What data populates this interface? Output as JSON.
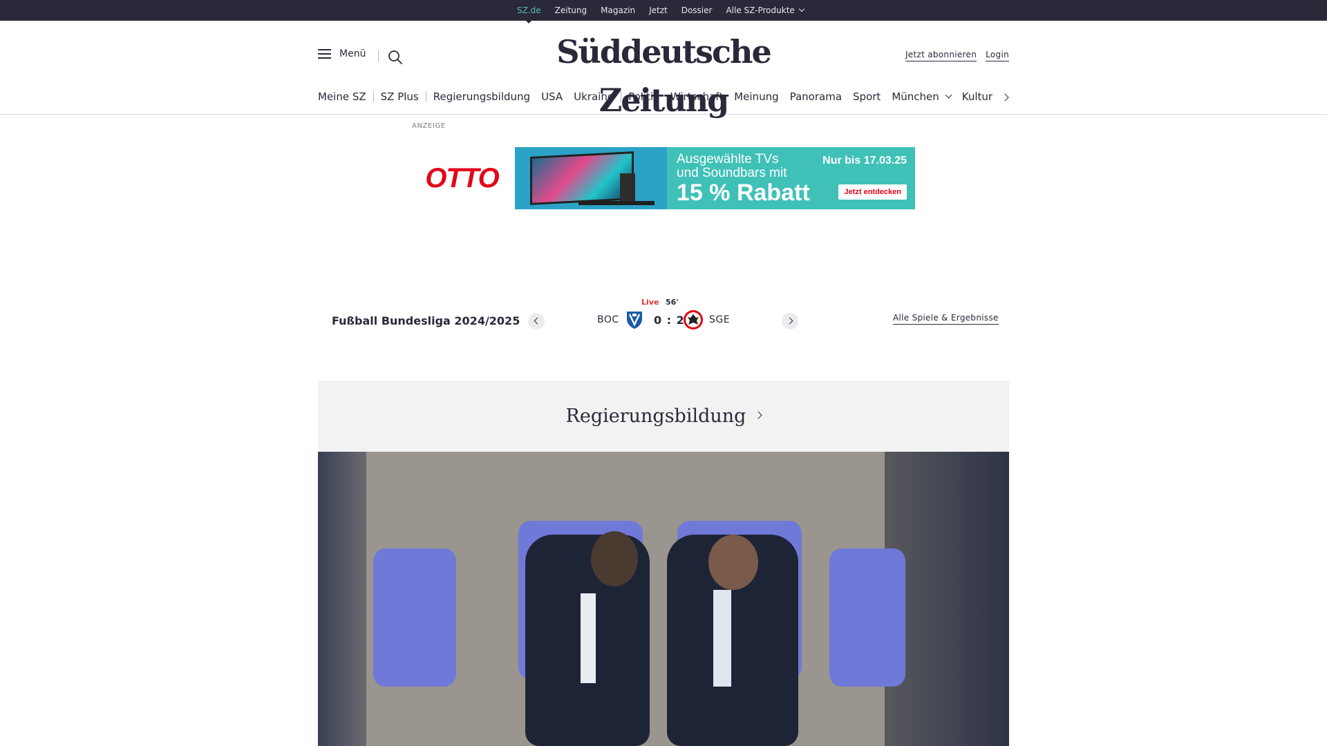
{
  "topbar": {
    "links": [
      "SZ.de",
      "Zeitung",
      "Magazin",
      "Jetzt",
      "Dossier",
      "Alle SZ-Produkte"
    ]
  },
  "header": {
    "menu_label": "Menü",
    "logo_text": "Süddeutsche Zeitung",
    "subscribe_label": "Jetzt abonnieren",
    "login_label": "Login"
  },
  "nav": {
    "items": [
      "Meine SZ",
      "SZ Plus",
      "Regierungsbildung",
      "USA",
      "Ukraine",
      "Politik",
      "Wirtschaft",
      "Meinung",
      "Panorama",
      "Sport",
      "München",
      "Kultur"
    ]
  },
  "ad": {
    "label": "ANZEIGE",
    "brand": "OTTO",
    "headline_line1": "Ausgewählte TVs",
    "headline_line2": "und Soundbars mit",
    "discount": "15 % Rabatt",
    "date": "Nur bis 17.03.25",
    "cta": "Jetzt entdecken"
  },
  "scoreboard": {
    "title": "Fußball Bundesliga 2024/2025",
    "status": "Live",
    "minute": "56'",
    "home_team": "BOC",
    "away_team": "SGE",
    "score": "0 : 2",
    "all_games_label": "Alle Spiele & Ergebnisse"
  },
  "section": {
    "title": "Regierungsbildung"
  },
  "colors": {
    "brand_dark": "#29293a",
    "accent_link": "#5fb7c0",
    "live_red": "#e5322d",
    "otto_red": "#e3051b"
  }
}
